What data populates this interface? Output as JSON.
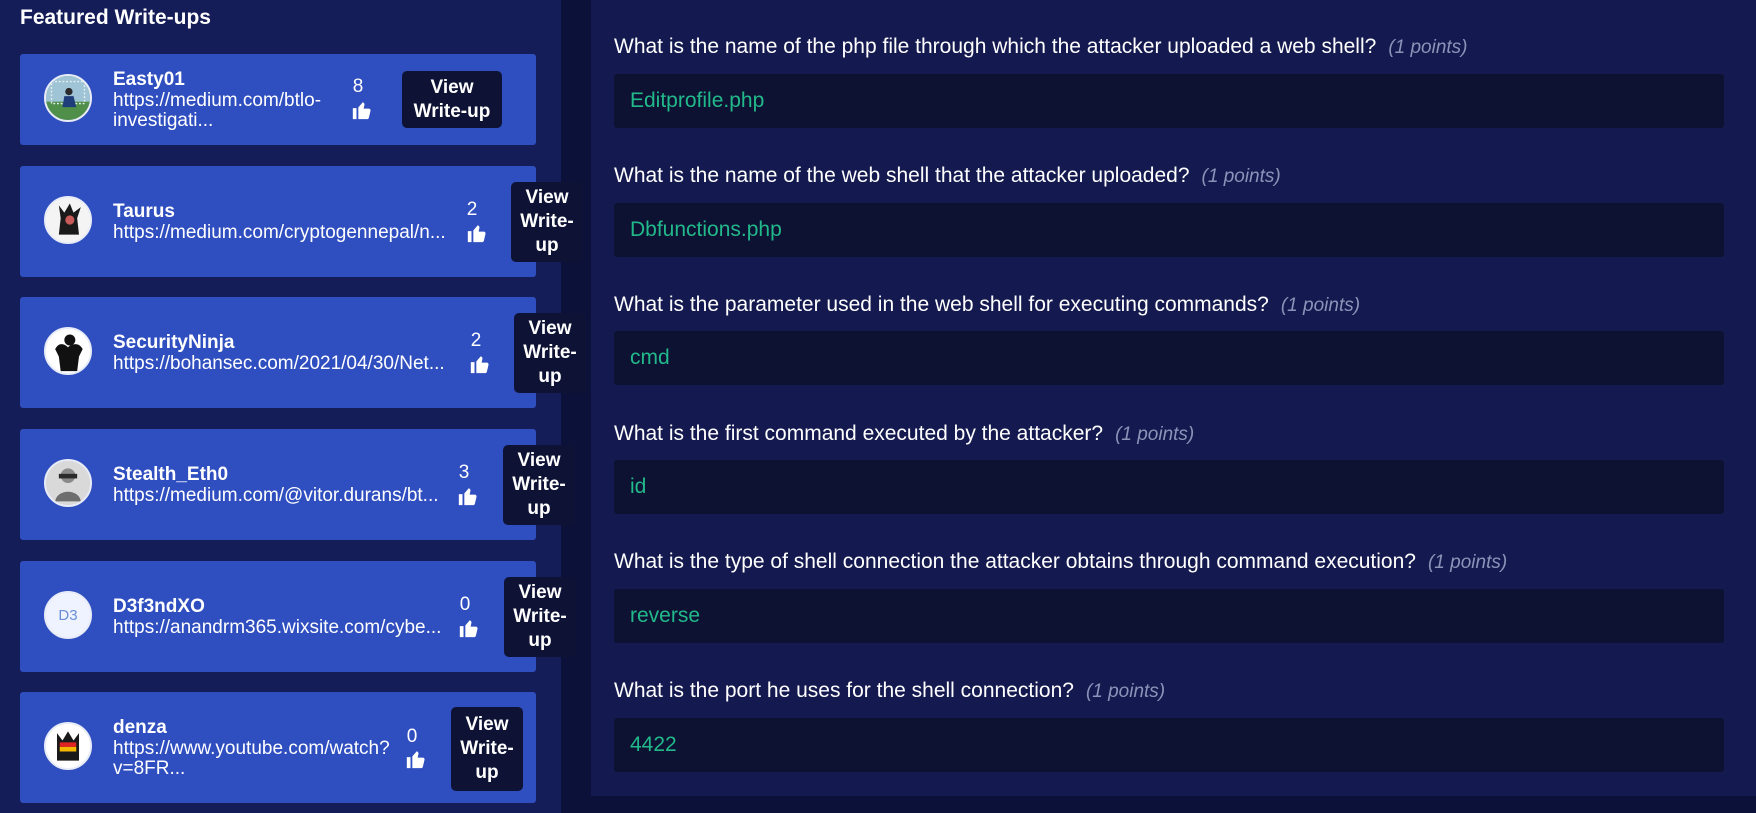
{
  "featured": {
    "title": "Featured Write-ups",
    "button_label": "View Write-up",
    "items": [
      {
        "name": "Easty01",
        "url": "https://medium.com/btlo-investigati...",
        "likes": "8"
      },
      {
        "name": "Taurus",
        "url": "https://medium.com/cryptogennepal/n...",
        "likes": "2"
      },
      {
        "name": "SecurityNinja",
        "url": "https://bohansec.com/2021/04/30/Net...",
        "likes": "2"
      },
      {
        "name": "Stealth_Eth0",
        "url": "https://medium.com/@vitor.durans/bt...",
        "likes": "3"
      },
      {
        "name": "D3f3ndXO",
        "url": "https://anandrm365.wixsite.com/cybe...",
        "likes": "0",
        "avatar_text": "D3"
      },
      {
        "name": "denza",
        "url": "https://www.youtube.com/watch?v=8FR...",
        "likes": "0"
      }
    ]
  },
  "questions": [
    {
      "text": "What is the name of the php file through which the attacker uploaded a web shell?",
      "points": "(1 points)",
      "answer": "Editprofile.php"
    },
    {
      "text": "What is the name of the web shell that the attacker uploaded?",
      "points": "(1 points)",
      "answer": "Dbfunctions.php"
    },
    {
      "text": "What is the parameter used in the web shell for executing commands?",
      "points": "(1 points)",
      "answer": "cmd"
    },
    {
      "text": "What is the first command executed by the attacker?",
      "points": "(1 points)",
      "answer": "id"
    },
    {
      "text": "What is the type of shell connection the attacker obtains through command execution?",
      "points": "(1 points)",
      "answer": "reverse"
    },
    {
      "text": "What is the port he uses for the shell connection?",
      "points": "(1 points)",
      "answer": "4422"
    }
  ],
  "colors": {
    "page_bg": "#0b1138",
    "left_panel": "#141d57",
    "card": "#2f4ebf",
    "button": "#0e1335",
    "right_panel": "#141a4f",
    "answer_bg": "#0d1233",
    "answer_text": "#22b98a",
    "points_text": "#8c93b8"
  },
  "icons": [
    "thumbs-up-icon",
    "avatar"
  ]
}
